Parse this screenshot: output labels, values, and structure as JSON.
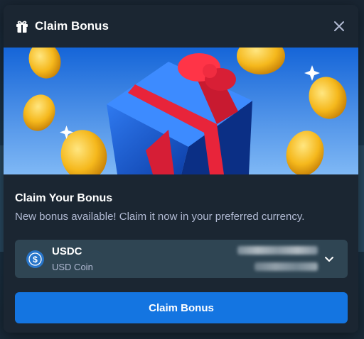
{
  "modal": {
    "title": "Claim Bonus",
    "header_icon": "gift-icon",
    "close_icon": "close-icon"
  },
  "content": {
    "heading": "Claim Your Bonus",
    "description": "New bonus available! Claim it now in your preferred currency."
  },
  "currency": {
    "code": "USDC",
    "name": "USD Coin",
    "icon": "usdc-coin-icon",
    "dropdown_icon": "chevron-down-icon"
  },
  "actions": {
    "claim_label": "Claim Bonus"
  },
  "colors": {
    "modal_bg": "#1b2632",
    "select_bg": "#2f4553",
    "primary_button": "#1475e1",
    "muted_text": "#b1bad3",
    "usdc_blue": "#2775ca"
  }
}
